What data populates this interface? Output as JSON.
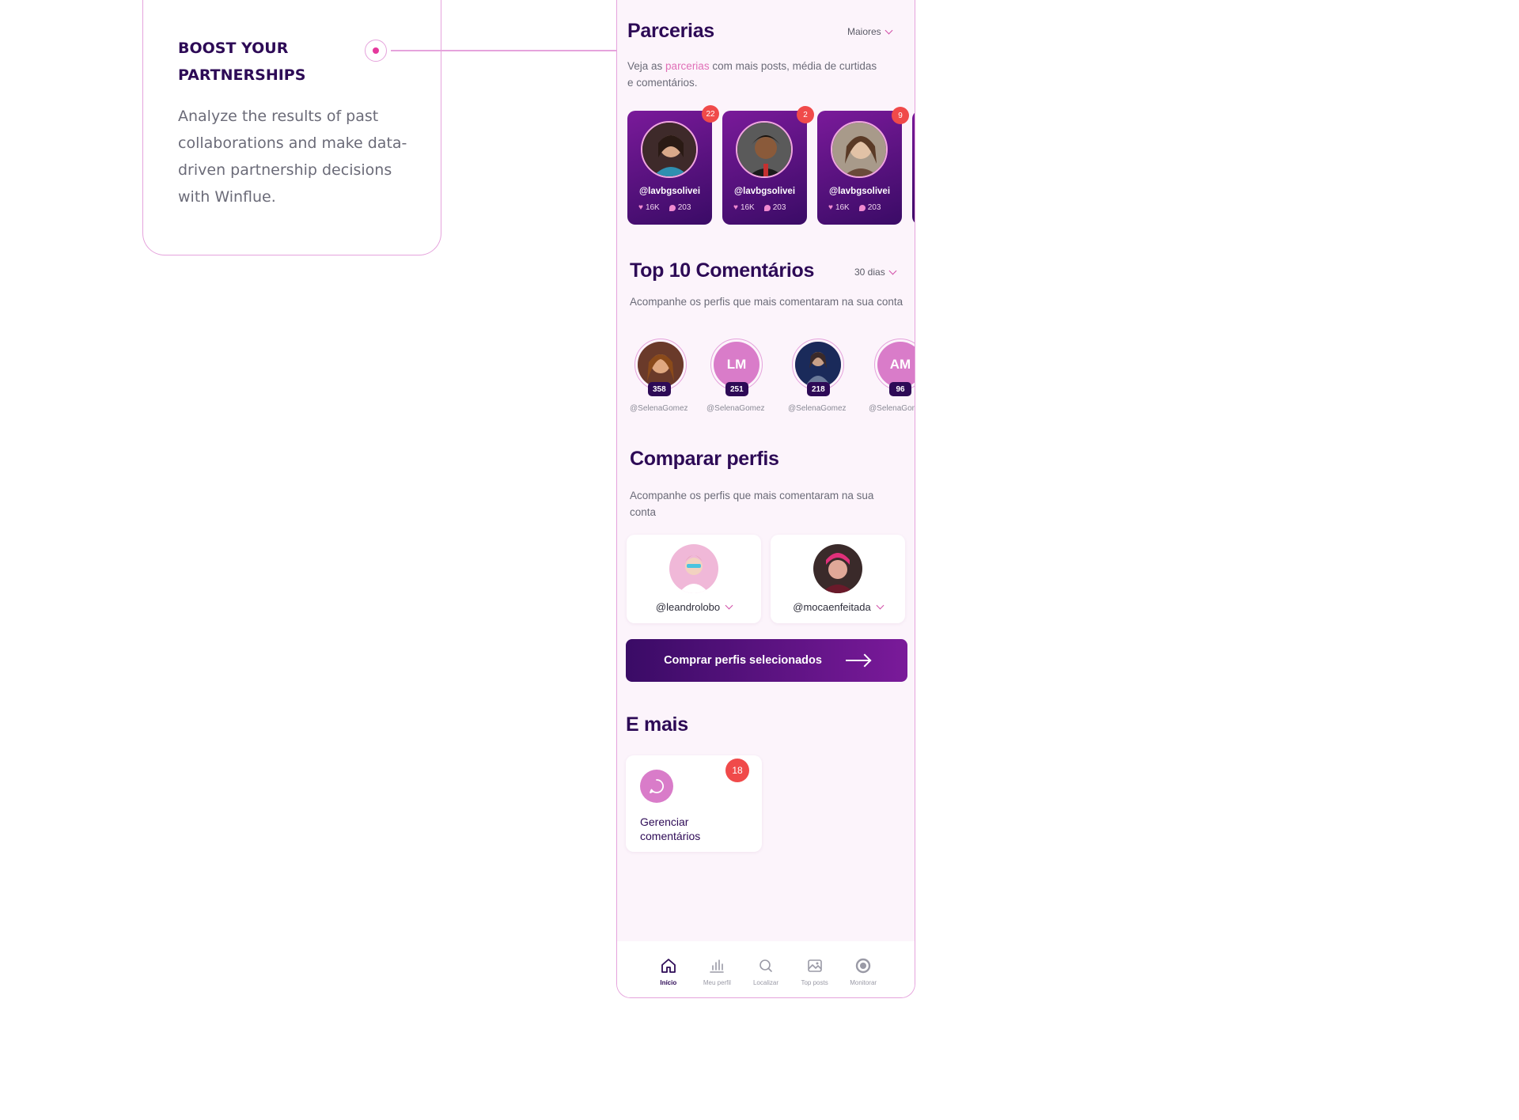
{
  "callout": {
    "title": "BOOST YOUR PARTNERSHIPS",
    "body": "Analyze the results of past collaborations and make data-driven partnership decisions with Winflue."
  },
  "partnerships": {
    "title": "Parcerias",
    "filter": "Maiores",
    "subtitle_pre": "Veja as ",
    "subtitle_link": "parcerias",
    "subtitle_post": " com mais posts, média de curtidas e comentários.",
    "cards": [
      {
        "handle": "@lavbgsolivei",
        "likes": "16K",
        "comments": "203",
        "badge": "22"
      },
      {
        "handle": "@lavbgsolivei",
        "likes": "16K",
        "comments": "203",
        "badge": "2"
      },
      {
        "handle": "@lavbgsolivei",
        "likes": "16K",
        "comments": "203",
        "badge": "9"
      }
    ]
  },
  "top_comments": {
    "title": "Top 10 Comentários",
    "filter": "30 dias",
    "subtitle": "Acompanhe os perfis que mais comentaram na sua conta",
    "profiles": [
      {
        "initials": "",
        "count": "358",
        "handle": "@SelenaGomez"
      },
      {
        "initials": "LM",
        "count": "251",
        "handle": "@SelenaGomez"
      },
      {
        "initials": "",
        "count": "218",
        "handle": "@SelenaGomez"
      },
      {
        "initials": "AM",
        "count": "96",
        "handle": "@SelenaGomez"
      }
    ]
  },
  "compare": {
    "title": "Comparar perfis",
    "subtitle": "Acompanhe os perfis que mais comentaram na sua conta",
    "profiles": [
      {
        "handle": "@leandrolobo"
      },
      {
        "handle": "@mocaenfeitada"
      }
    ],
    "cta": "Comprar perfis selecionados"
  },
  "more": {
    "title": "E mais",
    "card_label": "Gerenciar comentários",
    "card_badge": "18"
  },
  "nav": [
    {
      "label": "Início",
      "icon": "home-icon",
      "active": true
    },
    {
      "label": "Meu perfil",
      "icon": "bar-chart-icon",
      "active": false
    },
    {
      "label": "Localizar",
      "icon": "search-icon",
      "active": false
    },
    {
      "label": "Top posts",
      "icon": "image-icon",
      "active": false
    },
    {
      "label": "Monitorar",
      "icon": "monitor-icon",
      "active": false
    }
  ],
  "colors": {
    "brand_dark": "#2d0a56",
    "brand_purple": "#7a1a9a",
    "accent_pink": "#e06fb7",
    "badge_red": "#f04a4a"
  }
}
